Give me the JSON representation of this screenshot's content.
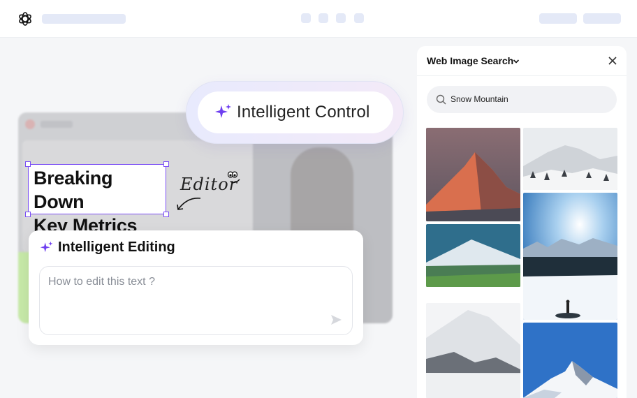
{
  "panel": {
    "title": "Web Image Search",
    "search": {
      "value": "Snow Mountain"
    }
  },
  "intelligent_control": {
    "label": "Intelligent Control"
  },
  "selected_text": {
    "line1": "Breaking Down",
    "line2": "Key Metrics"
  },
  "annotation": {
    "editor_label": "Editor"
  },
  "intelligent_editing": {
    "title": "Intelligent Editing",
    "placeholder": "How to edit this text ?"
  },
  "colors": {
    "accent": "#7b4ff5",
    "sparkle": "#6e3ff0"
  },
  "icons": [
    "openai-logo-icon",
    "sparkle-icon",
    "chevron-down-icon",
    "close-icon",
    "search-icon",
    "send-icon"
  ]
}
